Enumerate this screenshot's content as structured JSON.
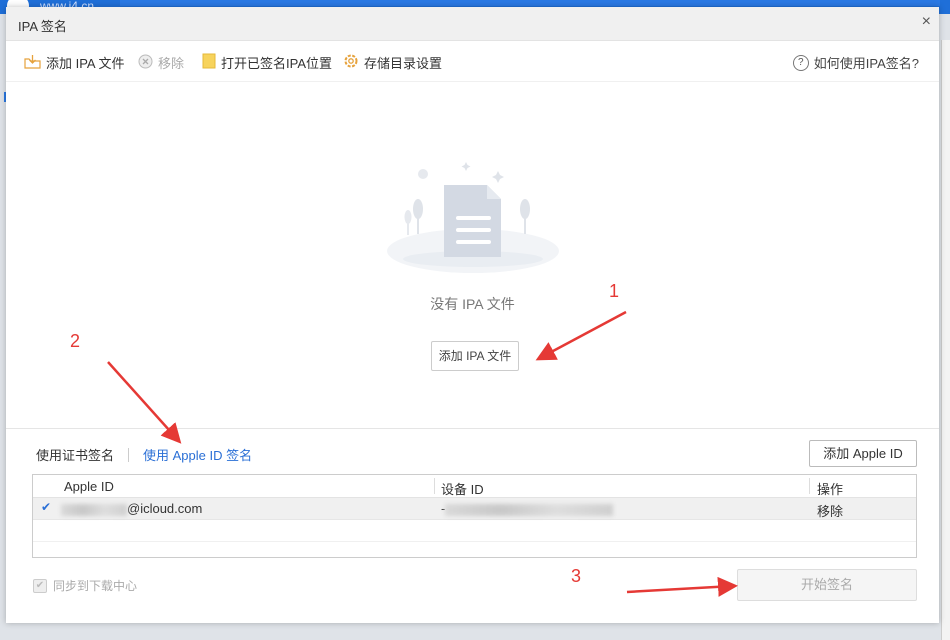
{
  "background": {
    "url_text": "www.i4.cn"
  },
  "dialog": {
    "title": "IPA 签名",
    "close_label": "×"
  },
  "toolbar": {
    "add_ipa": "添加 IPA 文件",
    "remove": "移除",
    "open_signed": "打开已签名IPA位置",
    "storage_settings": "存储目录设置",
    "help": "如何使用IPA签名?"
  },
  "empty_state": {
    "message": "没有 IPA 文件",
    "add_button": "添加 IPA 文件"
  },
  "signing": {
    "tabs": [
      "使用证书签名",
      "使用 Apple ID 签名"
    ],
    "active_tab": "使用 Apple ID 签名",
    "add_apple_id_button": "添加 Apple ID",
    "table": {
      "columns": [
        "Apple ID",
        "设备 ID",
        "操作"
      ],
      "rows": [
        {
          "checked": true,
          "apple_id_suffix": "@icloud.com",
          "device_id_prefix": "-",
          "action": "移除"
        }
      ]
    },
    "sync_label": "同步到下载中心",
    "start_button": "开始签名"
  },
  "annotations": [
    "1",
    "2",
    "3"
  ],
  "colors": {
    "accent": "#2a6fd6",
    "annotation": "#e53935",
    "brand_blue": "#1f6fd8"
  }
}
